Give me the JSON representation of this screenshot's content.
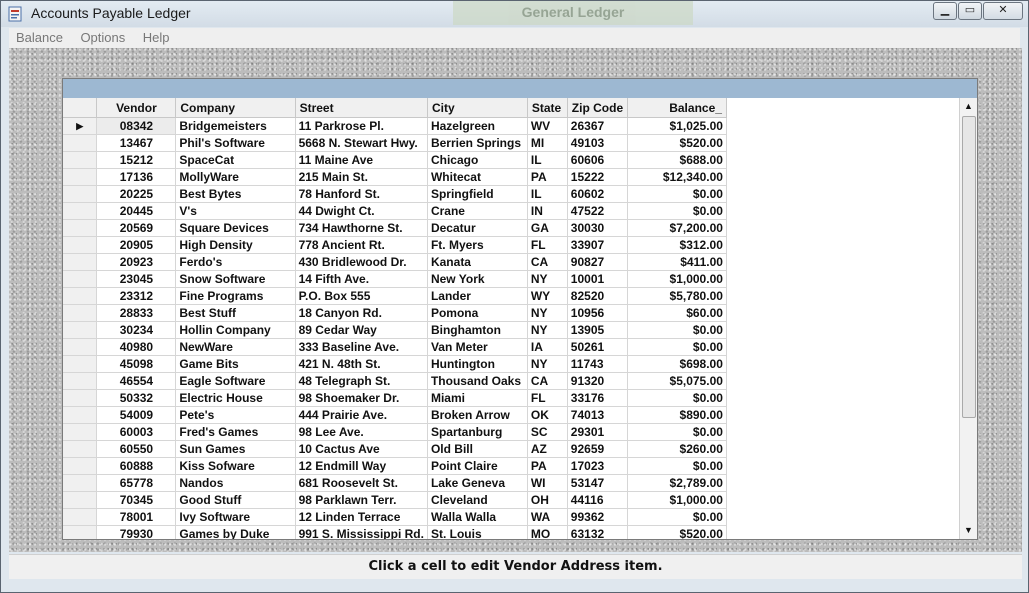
{
  "window": {
    "title": "Accounts Payable Ledger",
    "background_title": "General Ledger",
    "buttons": {
      "minimize": "▁",
      "maximize": "▭",
      "close": "✕"
    }
  },
  "menu": {
    "items": [
      {
        "label": "Balance"
      },
      {
        "label": "Options"
      },
      {
        "label": "Help"
      }
    ]
  },
  "grid": {
    "columns": [
      "Vendor",
      "Company",
      "Street",
      "City",
      "State",
      "Zip Code",
      "Balance_"
    ],
    "current_row_marker": "▶",
    "rows": [
      [
        "08342",
        "Bridgemeisters",
        "11 Parkrose Pl.",
        "Hazelgreen",
        "WV",
        "26367",
        "$1,025.00"
      ],
      [
        "13467",
        "Phil's Software",
        "5668 N. Stewart Hwy.",
        "Berrien Springs",
        "MI",
        "49103",
        "$520.00"
      ],
      [
        "15212",
        "SpaceCat",
        "11 Maine Ave",
        "Chicago",
        "IL",
        "60606",
        "$688.00"
      ],
      [
        "17136",
        "MollyWare",
        "215 Main St.",
        "Whitecat",
        "PA",
        "15222",
        "$12,340.00"
      ],
      [
        "20225",
        "Best Bytes",
        "78 Hanford St.",
        "Springfield",
        "IL",
        "60602",
        "$0.00"
      ],
      [
        "20445",
        "V's",
        "44 Dwight Ct.",
        "Crane",
        "IN",
        "47522",
        "$0.00"
      ],
      [
        "20569",
        "Square Devices",
        "734 Hawthorne St.",
        "Decatur",
        "GA",
        "30030",
        "$7,200.00"
      ],
      [
        "20905",
        "High Density",
        "778 Ancient Rt.",
        "Ft. Myers",
        "FL",
        "33907",
        "$312.00"
      ],
      [
        "20923",
        "Ferdo's",
        "430 Bridlewood Dr.",
        "Kanata",
        "CA",
        "90827",
        "$411.00"
      ],
      [
        "23045",
        "Snow Software",
        "14 Fifth Ave.",
        "New York",
        "NY",
        "10001",
        "$1,000.00"
      ],
      [
        "23312",
        "Fine Programs",
        "P.O. Box 555",
        "Lander",
        "WY",
        "82520",
        "$5,780.00"
      ],
      [
        "28833",
        "Best Stuff",
        "18 Canyon Rd.",
        "Pomona",
        "NY",
        "10956",
        "$60.00"
      ],
      [
        "30234",
        "Hollin Company",
        "89 Cedar Way",
        "Binghamton",
        "NY",
        "13905",
        "$0.00"
      ],
      [
        "40980",
        "NewWare",
        "333 Baseline Ave.",
        "Van Meter",
        "IA",
        "50261",
        "$0.00"
      ],
      [
        "45098",
        "Game Bits",
        "421 N. 48th St.",
        "Huntington",
        "NY",
        "11743",
        "$698.00"
      ],
      [
        "46554",
        "Eagle Software",
        "48 Telegraph St.",
        "Thousand Oaks",
        "CA",
        "91320",
        "$5,075.00"
      ],
      [
        "50332",
        "Electric House",
        "98 Shoemaker Dr.",
        "Miami",
        "FL",
        "33176",
        "$0.00"
      ],
      [
        "54009",
        "Pete's",
        "444 Prairie Ave.",
        "Broken Arrow",
        "OK",
        "74013",
        "$890.00"
      ],
      [
        "60003",
        "Fred's Games",
        "98 Lee Ave.",
        "Spartanburg",
        "SC",
        "29301",
        "$0.00"
      ],
      [
        "60550",
        "Sun Games",
        "10 Cactus Ave",
        "Old Bill",
        "AZ",
        "92659",
        "$260.00"
      ],
      [
        "60888",
        "Kiss Sofware",
        "12 Endmill Way",
        "Point Claire",
        "PA",
        "17023",
        "$0.00"
      ],
      [
        "65778",
        "Nandos",
        "681 Roosevelt St.",
        "Lake Geneva",
        "WI",
        "53147",
        "$2,789.00"
      ],
      [
        "70345",
        "Good Stuff",
        "98 Parklawn Terr.",
        "Cleveland",
        "OH",
        "44116",
        "$1,000.00"
      ],
      [
        "78001",
        "Ivy Software",
        "12 Linden Terrace",
        "Walla Walla",
        "WA",
        "99362",
        "$0.00"
      ],
      [
        "79930",
        "Games by Duke",
        "991 S. Mississippi Rd.",
        "St. Louis",
        "MO",
        "63132",
        "$520.00"
      ]
    ]
  },
  "scrollbar": {
    "up": "▲",
    "down": "▼"
  },
  "status": {
    "text": "Click a cell to edit Vendor Address item."
  }
}
